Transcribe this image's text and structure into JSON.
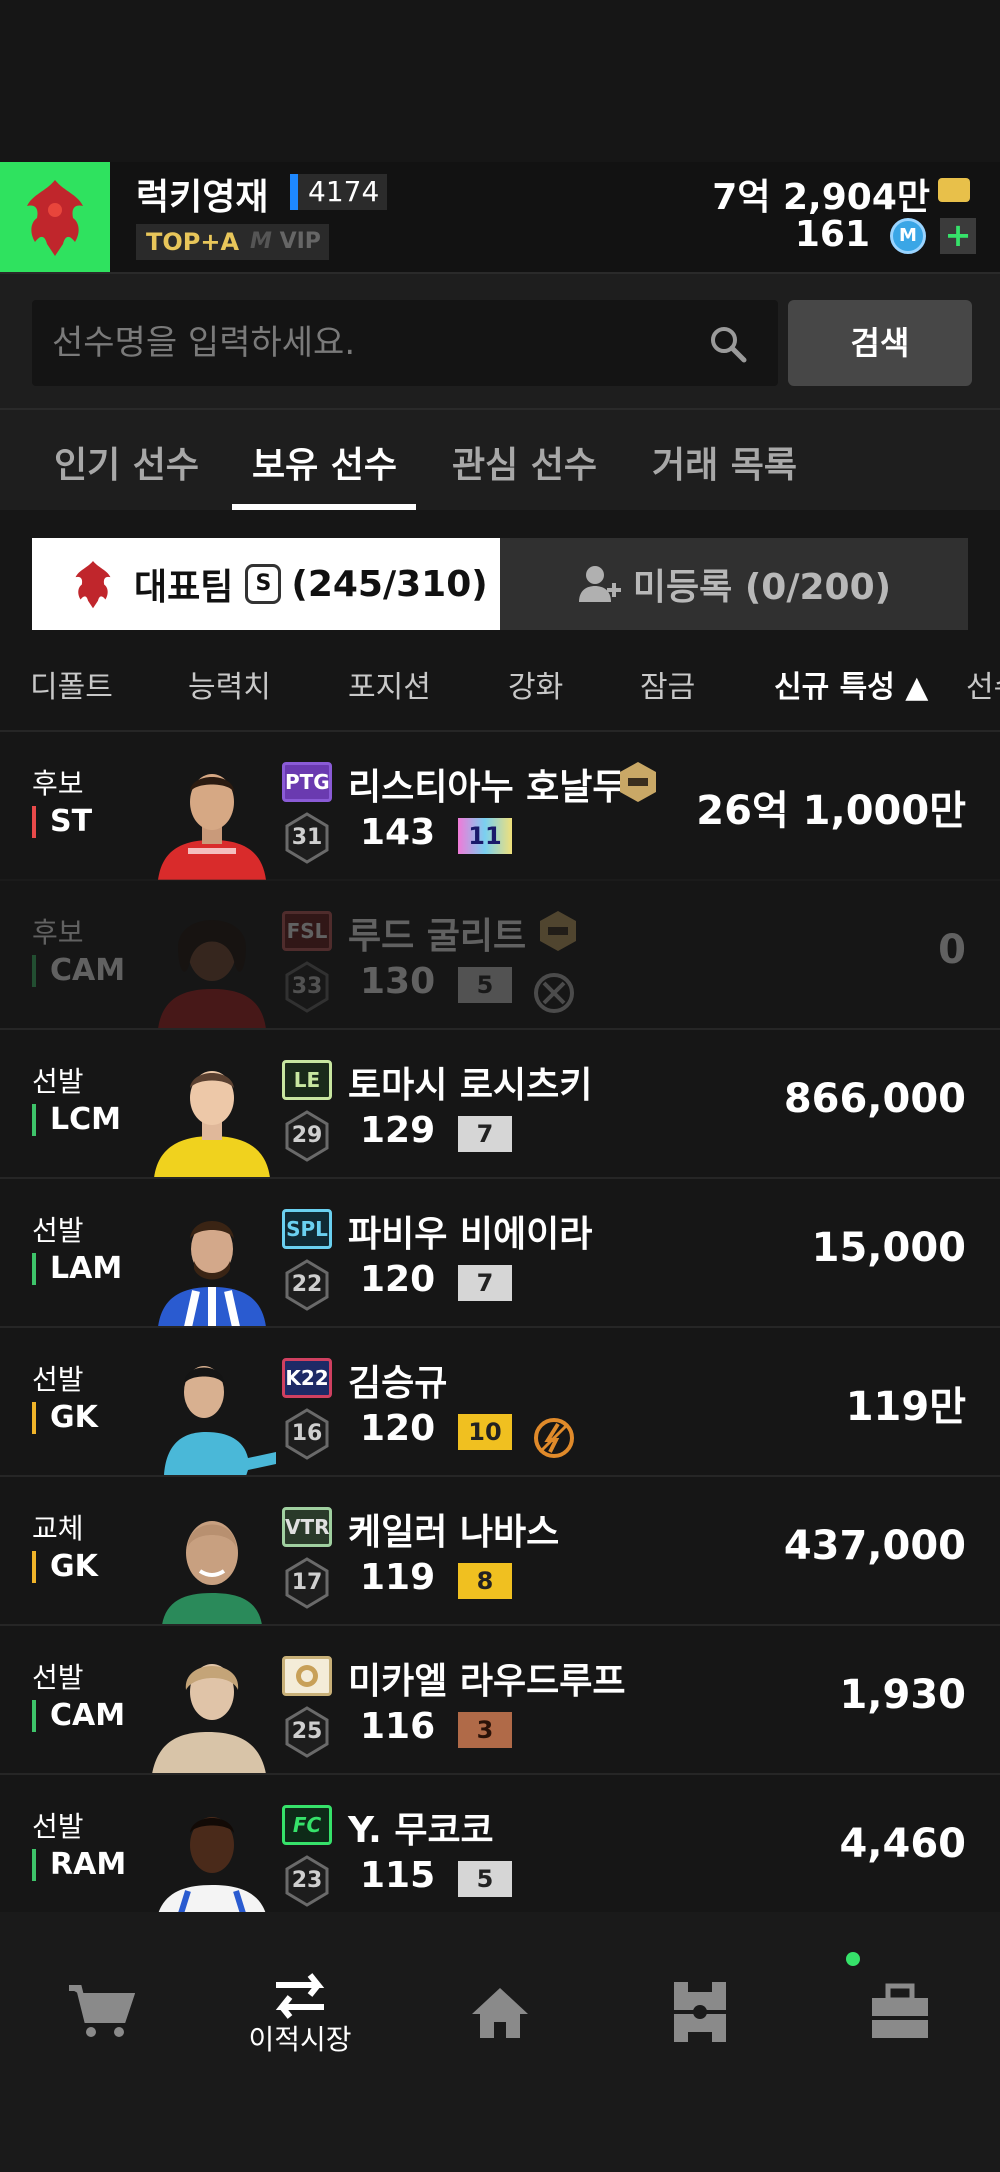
{
  "header": {
    "username": "럭키영재",
    "level": "4174",
    "rank": "TOP+A",
    "vip": "VIP",
    "money": "7억 2,904만",
    "mc": "161",
    "mc_symbol": "M",
    "plus": "+",
    "crest_color": "#2fe25f"
  },
  "search": {
    "placeholder": "선수명을 입력하세요.",
    "button": "검색"
  },
  "tabs": [
    "인기 선수",
    "보유 선수",
    "관심 선수",
    "거래 목록"
  ],
  "segment": {
    "left": "대표팀",
    "left_badge": "S",
    "left_count": "(245/310)",
    "right": "미등록 (0/200)"
  },
  "sort": [
    "디폴트",
    "능력치",
    "포지션",
    "강화",
    "잠금",
    "신규 특성 ▲",
    "선수"
  ],
  "players": [
    {
      "role": "후보",
      "pos": "ST",
      "season": "PTG",
      "salary": "31",
      "name": "리스티아누 호날두",
      "ovr": "143",
      "grade": "11",
      "price": "26억 1,000만"
    },
    {
      "role": "후보",
      "pos": "CAM",
      "season": "FSL",
      "salary": "33",
      "name": "루드 굴리트",
      "ovr": "130",
      "grade": "5",
      "price": "0"
    },
    {
      "role": "선발",
      "pos": "LCM",
      "season": "LE",
      "salary": "29",
      "name": "토마시 로시츠키",
      "ovr": "129",
      "grade": "7",
      "price": "866,000"
    },
    {
      "role": "선발",
      "pos": "LAM",
      "season": "SPL",
      "salary": "22",
      "name": "파비우 비에이라",
      "ovr": "120",
      "grade": "7",
      "price": "15,000"
    },
    {
      "role": "선발",
      "pos": "GK",
      "season": "K22",
      "salary": "16",
      "name": "김승규",
      "ovr": "120",
      "grade": "10",
      "price": "119만"
    },
    {
      "role": "교체",
      "pos": "GK",
      "season": "VTR",
      "salary": "17",
      "name": "케일러 나바스",
      "ovr": "119",
      "grade": "8",
      "price": "437,000"
    },
    {
      "role": "선발",
      "pos": "CAM",
      "season": "",
      "salary": "25",
      "name": "미카엘 라우드루프",
      "ovr": "116",
      "grade": "3",
      "price": "1,930"
    },
    {
      "role": "선발",
      "pos": "RAM",
      "season": "FC",
      "salary": "23",
      "name": "Y. 무코코",
      "ovr": "115",
      "grade": "5",
      "price": "4,460"
    }
  ],
  "nav": {
    "transfer_label": "이적시장"
  }
}
